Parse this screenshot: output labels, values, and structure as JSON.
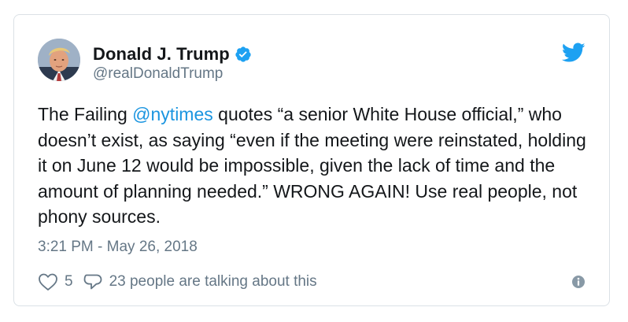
{
  "author": {
    "display_name": "Donald J. Trump",
    "handle": "@realDonaldTrump",
    "verified": true,
    "avatar_icon": "profile-photo"
  },
  "tweet": {
    "text_before": "The Failing ",
    "mention": "@nytimes",
    "text_after": " quotes “a senior White House official,” who doesn’t exist, as saying “even if the meeting were reinstated, holding it on June 12 would be impossible, given the lack of time and the amount of planning needed.” WRONG AGAIN! Use real people, not phony sources.",
    "timestamp": "3:21 PM - May 26, 2018"
  },
  "actions": {
    "like_count": "5",
    "reply_text": "23 people are talking about this"
  },
  "icons": {
    "brand": "twitter-bird-icon",
    "verified": "verified-badge-icon",
    "like": "heart-icon",
    "reply": "speech-bubble-icon",
    "info": "info-icon"
  },
  "colors": {
    "brand_blue": "#1da1f2",
    "link_blue": "#1b95e0",
    "text_primary": "#14171a",
    "text_secondary": "#657786",
    "border": "#dbe1e6"
  }
}
